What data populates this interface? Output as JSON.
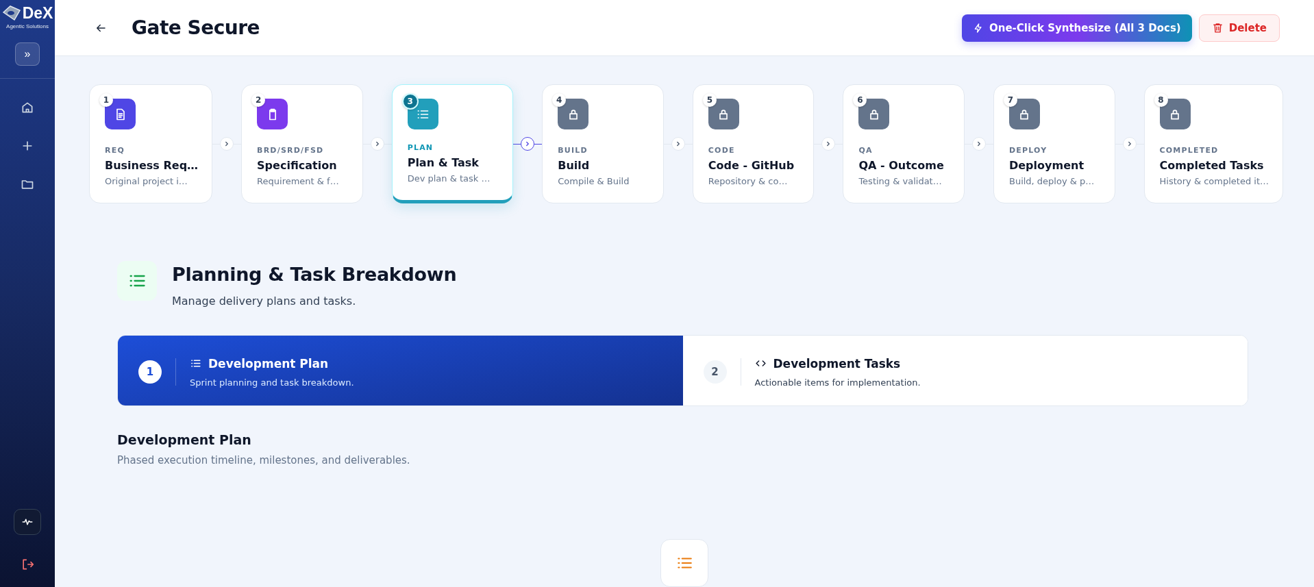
{
  "sidebar": {
    "logo": {
      "name": "DeX",
      "tagline": "Agentic Solutions"
    },
    "expand_button": "»",
    "nav": [
      {
        "kind": "home"
      },
      {
        "kind": "plus"
      },
      {
        "kind": "folder"
      }
    ],
    "bottom": [
      {
        "kind": "activity"
      },
      {
        "kind": "logout"
      }
    ]
  },
  "header": {
    "title": "Gate Secure",
    "synthesize_button": "One-Click Synthesize (All 3 Docs)",
    "delete_button": "Delete"
  },
  "steps": [
    {
      "number": "1",
      "label": "REQ",
      "title": "Business Req…",
      "subtitle": "Original project i…",
      "kind": "document",
      "color": "#4f46e5",
      "selected": false
    },
    {
      "number": "2",
      "label": "BRD/SRD/FSD",
      "title": "Specification",
      "subtitle": "Requirement & f…",
      "kind": "clipboard",
      "color": "#7c3aed",
      "selected": false
    },
    {
      "number": "3",
      "label": "PLAN",
      "title": "Plan & Task",
      "subtitle": "Dev plan & task …",
      "kind": "list",
      "color": "#229fbb",
      "selected": true
    },
    {
      "number": "4",
      "label": "BUILD",
      "title": "Build",
      "subtitle": "Compile & Build",
      "kind": "lock",
      "color": "#64748b",
      "selected": false
    },
    {
      "number": "5",
      "label": "CODE",
      "title": "Code - GitHub",
      "subtitle": "Repository & co…",
      "kind": "lock",
      "color": "#64748b",
      "selected": false
    },
    {
      "number": "6",
      "label": "QA",
      "title": "QA - Outcome",
      "subtitle": "Testing & validat…",
      "kind": "lock",
      "color": "#64748b",
      "selected": false
    },
    {
      "number": "7",
      "label": "DEPLOY",
      "title": "Deployment",
      "subtitle": "Build, deploy & p…",
      "kind": "lock",
      "color": "#64748b",
      "selected": false
    },
    {
      "number": "8",
      "label": "COMPLETED",
      "title": "Completed Tasks",
      "subtitle": "History & completed it…",
      "kind": "lock",
      "color": "#64748b",
      "selected": false
    }
  ],
  "section": {
    "title": "Planning & Task Breakdown",
    "subtitle": "Manage delivery plans and tasks."
  },
  "tabs": [
    {
      "number": "1",
      "kind": "list",
      "title": "Development Plan",
      "subtitle": "Sprint planning and task breakdown.",
      "selected": true
    },
    {
      "number": "2",
      "kind": "code",
      "title": "Development Tasks",
      "subtitle": "Actionable items for implementation.",
      "selected": false
    }
  ],
  "content": {
    "title": "Development Plan",
    "subtitle": "Phased execution timeline, milestones, and deliverables."
  }
}
